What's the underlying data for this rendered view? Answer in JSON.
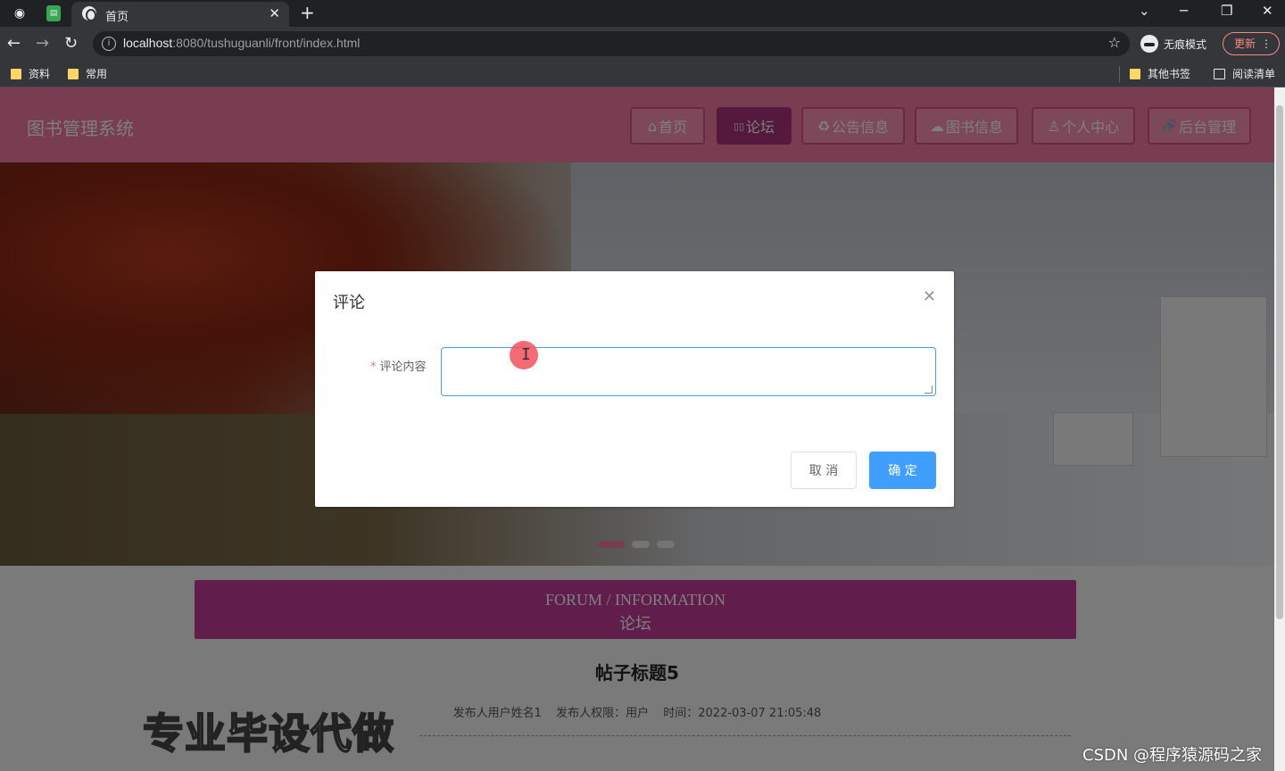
{
  "browser": {
    "tab_title": "首页",
    "new_tab_symbol": "+",
    "url_host": "localhost",
    "url_rest": ":8080/tushuguanli/front/index.html",
    "incognito_label": "无痕模式",
    "update_label": "更新",
    "bookmarks": [
      "资料",
      "常用"
    ],
    "other_bookmarks": "其他书签",
    "reading_list": "阅读清单"
  },
  "site": {
    "title": "图书管理系统",
    "nav": [
      {
        "icon": "⌂",
        "label": "首页"
      },
      {
        "icon": "▯▯",
        "label": "论坛",
        "active": true
      },
      {
        "icon": "♻",
        "label": "公告信息"
      },
      {
        "icon": "☁",
        "label": "图书信息"
      },
      {
        "icon": "♙",
        "label": "个人中心"
      },
      {
        "icon": "🔗",
        "label": "后台管理"
      }
    ],
    "accent_color": "#f07ba3",
    "active_nav_color": "#a83279"
  },
  "section": {
    "en": "FORUM / INFORMATION",
    "cn": "论坛"
  },
  "post": {
    "title": "帖子标题5",
    "author": "发布人用户姓名1",
    "role": "发布人权限：用户",
    "time": "时间：2022-03-07 21:05:48"
  },
  "dialog": {
    "title": "评论",
    "field_label": "评论内容",
    "field_value": "",
    "cancel_label": "取 消",
    "ok_label": "确 定",
    "primary_color": "#409eff"
  },
  "watermarks": {
    "promo": "专业毕设代做",
    "csdn": "CSDN @程序猿源码之家"
  }
}
